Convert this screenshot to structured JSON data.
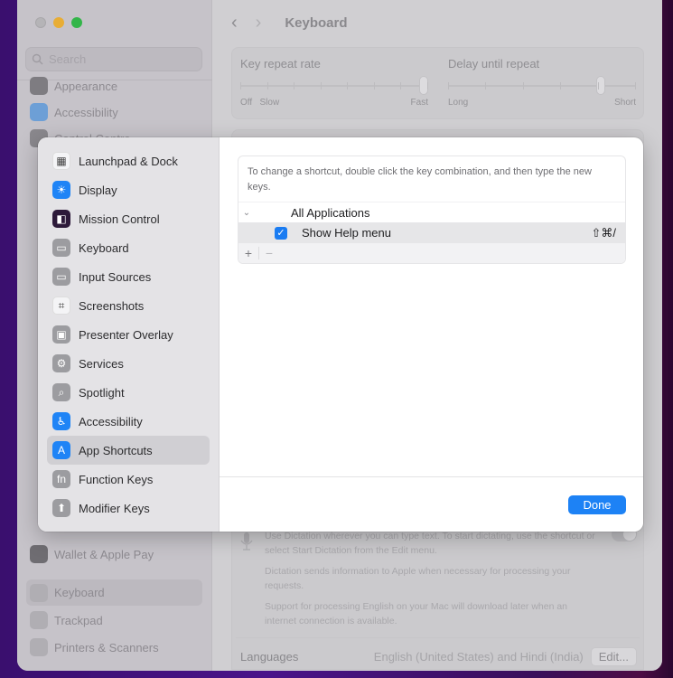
{
  "window": {
    "title": "Keyboard",
    "search_placeholder": "Search"
  },
  "sidebar": {
    "items_top": [
      {
        "label": "Appearance",
        "icon": "appearance-icon"
      },
      {
        "label": "Accessibility",
        "icon": "accessibility-icon"
      },
      {
        "label": "Control Centre",
        "icon": "control-centre-icon"
      }
    ],
    "items_bottom": [
      {
        "label": "Wallet & Apple Pay",
        "icon": "wallet-icon"
      },
      {
        "label": "Keyboard",
        "icon": "keyboard-icon",
        "selected": true
      },
      {
        "label": "Trackpad",
        "icon": "trackpad-icon"
      },
      {
        "label": "Printers & Scanners",
        "icon": "printer-icon"
      }
    ]
  },
  "main": {
    "key_repeat": {
      "label": "Key repeat rate",
      "min_labels": [
        "Off",
        "Slow"
      ],
      "max_label": "Fast",
      "value_fraction": 1.0
    },
    "delay_repeat": {
      "label": "Delay until repeat",
      "min_label": "Long",
      "max_label": "Short",
      "value_fraction": 0.83
    },
    "dictation": {
      "description": "Use Dictation wherever you can type text. To start dictating, use the shortcut or select Start Dictation from the Edit menu.",
      "privacy": "Dictation sends information to Apple when necessary for processing your requests.",
      "download_note": "Support for processing English on your Mac will download later when an internet connection is available.",
      "enabled": false
    },
    "languages": {
      "label": "Languages",
      "value": "English (United States) and Hindi (India)",
      "edit_label": "Edit..."
    }
  },
  "sheet": {
    "sidebar": [
      {
        "label": "Launchpad & Dock",
        "icon": "launchpad-icon"
      },
      {
        "label": "Display",
        "icon": "display-icon"
      },
      {
        "label": "Mission Control",
        "icon": "mission-control-icon"
      },
      {
        "label": "Keyboard",
        "icon": "keyboard-icon"
      },
      {
        "label": "Input Sources",
        "icon": "input-sources-icon"
      },
      {
        "label": "Screenshots",
        "icon": "screenshots-icon"
      },
      {
        "label": "Presenter Overlay",
        "icon": "presenter-overlay-icon"
      },
      {
        "label": "Services",
        "icon": "services-icon"
      },
      {
        "label": "Spotlight",
        "icon": "spotlight-icon"
      },
      {
        "label": "Accessibility",
        "icon": "accessibility-icon"
      },
      {
        "label": "App Shortcuts",
        "icon": "app-shortcuts-icon",
        "selected": true
      },
      {
        "label": "Function Keys",
        "icon": "function-keys-icon"
      },
      {
        "label": "Modifier Keys",
        "icon": "modifier-keys-icon"
      }
    ],
    "hint": "To change a shortcut, double click the key combination, and then type the new keys.",
    "group": {
      "label": "All Applications",
      "expanded": true
    },
    "shortcuts": [
      {
        "label": "Show Help menu",
        "checked": true,
        "keys": "⇧⌘/"
      }
    ],
    "add_label": "+",
    "remove_label": "−",
    "done_label": "Done",
    "accent": "#1d82f5"
  }
}
